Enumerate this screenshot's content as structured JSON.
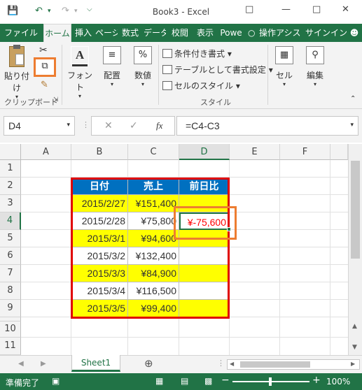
{
  "window": {
    "title": "Book3 - Excel"
  },
  "tabs": [
    "ファイル",
    "ホーム",
    "挿入",
    "ページ",
    "数式",
    "データ",
    "校閲",
    "表示",
    "Powe"
  ],
  "tell_me": "操作アシス",
  "signin": "サインイン",
  "ribbon": {
    "paste": "貼り付け",
    "clipboard": "クリップボード",
    "font": "フォント",
    "alignment": "配置",
    "number": "数値",
    "percent": "%",
    "cond_format": "条件付き書式",
    "format_table": "テーブルとして書式設定",
    "cell_styles": "セルのスタイル",
    "styles": "スタイル",
    "cells": "セル",
    "editing": "編集"
  },
  "formula_bar": {
    "name_box": "D4",
    "fx": "fx",
    "formula": "=C4-C3"
  },
  "columns": [
    "A",
    "B",
    "C",
    "D",
    "E",
    "F"
  ],
  "rows": [
    "1",
    "2",
    "3",
    "4",
    "5",
    "6",
    "7",
    "8",
    "9",
    "10",
    "11"
  ],
  "table": {
    "headers": [
      "日付",
      "売上",
      "前日比"
    ],
    "rows": [
      [
        "2015/2/27",
        "¥151,400",
        ""
      ],
      [
        "2015/2/28",
        "¥75,800",
        "¥-75,600"
      ],
      [
        "2015/3/1",
        "¥94,600",
        ""
      ],
      [
        "2015/3/2",
        "¥132,400",
        ""
      ],
      [
        "2015/3/3",
        "¥84,900",
        ""
      ],
      [
        "2015/3/4",
        "¥116,500",
        ""
      ],
      [
        "2015/3/5",
        "¥99,400",
        ""
      ]
    ]
  },
  "sheet_tab": "Sheet1",
  "status": {
    "mode": "準備完了",
    "zoom": "100%"
  },
  "colors": {
    "excel_green": "#217346",
    "header_blue": "#0070c0",
    "highlight_yellow": "#ffff00",
    "table_border_red": "#e00000",
    "annotation_orange": "#ed7d31",
    "negative_red": "#ff0000"
  }
}
